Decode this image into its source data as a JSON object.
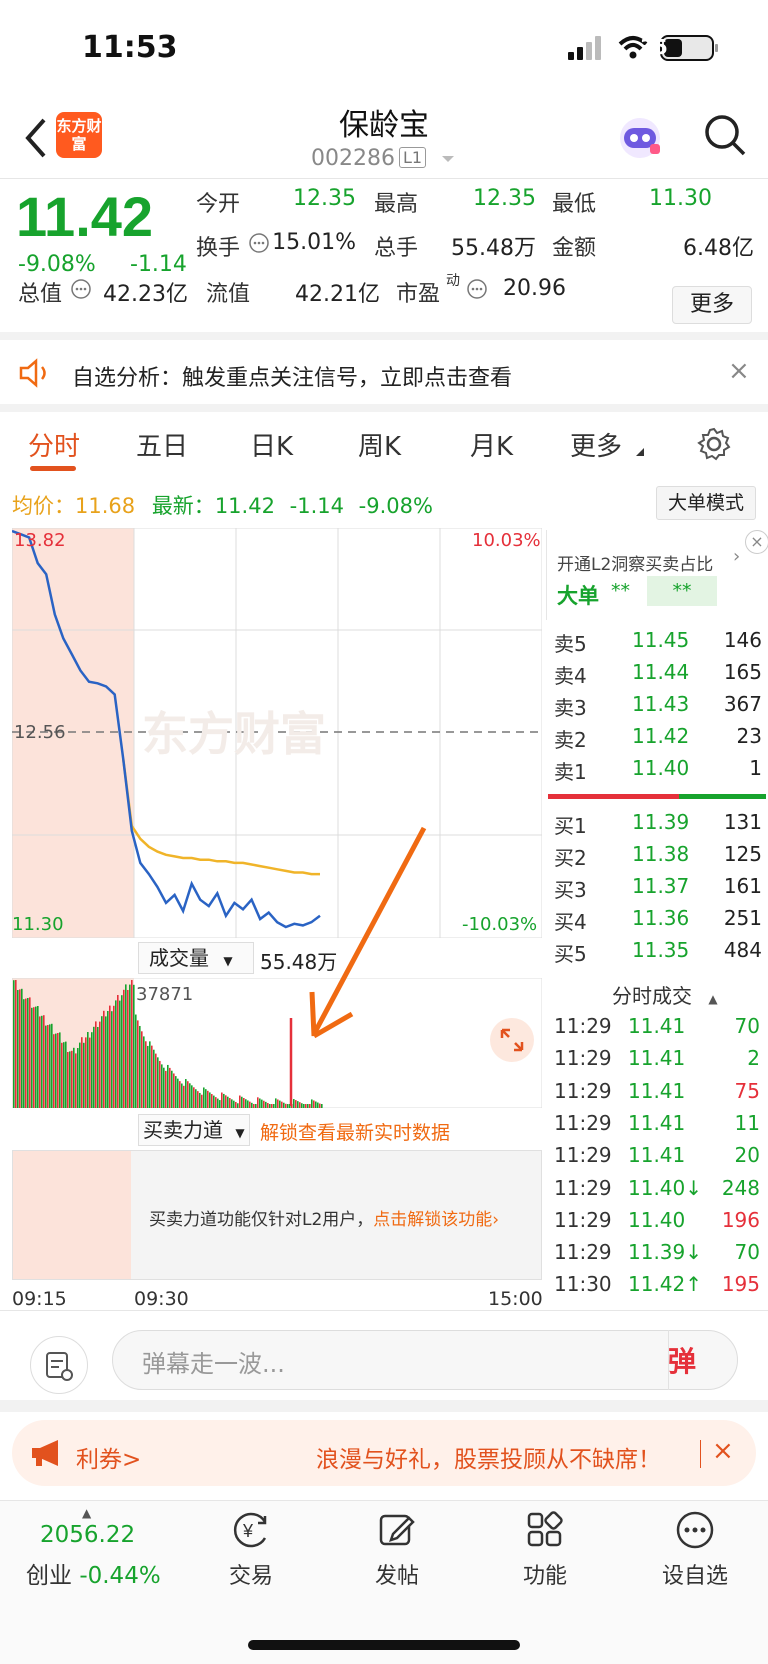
{
  "status_bar": {
    "time": "11:53",
    "battery": "35"
  },
  "header": {
    "logo_text": "东方财富",
    "title": "保龄宝",
    "code": "002286",
    "level_tag": "L1"
  },
  "quote": {
    "price": "11.42",
    "change_pct": "-9.08%",
    "change": "-1.14",
    "stats": [
      {
        "label": "今开",
        "value": "12.35",
        "color": "green"
      },
      {
        "label": "最高",
        "value": "12.35",
        "color": "green"
      },
      {
        "label": "最低",
        "value": "11.30",
        "color": "green"
      },
      {
        "label": "换手",
        "value": "15.01%",
        "color": "black"
      },
      {
        "label": "总手",
        "value": "55.48万",
        "color": "black"
      },
      {
        "label": "金额",
        "value": "6.48亿",
        "color": "black"
      },
      {
        "label": "总值",
        "value": "42.23亿",
        "color": "black"
      },
      {
        "label": "流值",
        "value": "42.21亿",
        "color": "black"
      },
      {
        "label": "市盈",
        "value": "20.96",
        "color": "black"
      }
    ],
    "pe_sup": "动",
    "more_button": "更多"
  },
  "banner": {
    "text": "自选分析：触发重点关注信号，立即点击查看",
    "close": "×"
  },
  "tabs": [
    "分时",
    "五日",
    "日K",
    "周K",
    "月K",
    "更多"
  ],
  "info_row": {
    "avg_label": "均价：",
    "avg_value": "11.68",
    "latest_label": "最新：",
    "latest_value": "11.42",
    "change": "-1.14",
    "pct": "-9.08%",
    "mode_button": "大单模式"
  },
  "chart_labels": {
    "top_price": "13.82",
    "top_pct": "10.03%",
    "mid_price": "12.56",
    "bottom_price": "11.30",
    "bottom_pct": "-10.03%",
    "volume_selector": "成交量",
    "volume_total": "55.48万",
    "volume_max": "37871",
    "force_selector": "买卖力道",
    "force_unlock": "解锁查看最新实时数据",
    "force_note": "买卖力道功能仅针对L2用户，",
    "force_link": "点击解锁该功能",
    "time_start": "09:15",
    "time_mid": "09:30",
    "time_end": "15:00",
    "watermark": "东方财富"
  },
  "chart_data": {
    "type": "line",
    "title": "",
    "xlabel": "",
    "ylabel": "",
    "ylim": [
      11.3,
      13.82
    ],
    "x_ticks": [
      "09:15",
      "09:30",
      "15:00"
    ],
    "series": [
      {
        "values": [
          13.82,
          13.8,
          13.78,
          13.62,
          13.55,
          13.3,
          13.15,
          13.05,
          12.95,
          12.88,
          12.87,
          12.85,
          12.8,
          12.4,
          11.95,
          11.75,
          11.68,
          11.6,
          11.5,
          11.55,
          11.45,
          11.62,
          11.52,
          11.48,
          11.56,
          11.42,
          11.5,
          11.46,
          11.52,
          11.4,
          11.44,
          11.38,
          11.35,
          11.37,
          11.36,
          11.38,
          11.42
        ],
        "color": "#2a63c4"
      },
      {
        "values": [
          null,
          null,
          null,
          null,
          null,
          null,
          null,
          null,
          null,
          null,
          null,
          null,
          null,
          12.4,
          11.98,
          11.9,
          11.85,
          11.82,
          11.8,
          11.79,
          11.78,
          11.78,
          11.77,
          11.77,
          11.76,
          11.76,
          11.75,
          11.75,
          11.74,
          11.73,
          11.72,
          11.71,
          11.7,
          11.69,
          11.69,
          11.68,
          11.68
        ],
        "color": "#f0b429"
      }
    ]
  },
  "order_book": {
    "header": "开通L2洞察买卖占比",
    "big_order": "大单",
    "masked": "**",
    "asks": [
      {
        "label": "卖5",
        "price": "11.45",
        "vol": "146"
      },
      {
        "label": "卖4",
        "price": "11.44",
        "vol": "165"
      },
      {
        "label": "卖3",
        "price": "11.43",
        "vol": "367"
      },
      {
        "label": "卖2",
        "price": "11.42",
        "vol": "23"
      },
      {
        "label": "卖1",
        "price": "11.40",
        "vol": "1"
      }
    ],
    "bids": [
      {
        "label": "买1",
        "price": "11.39",
        "vol": "131"
      },
      {
        "label": "买2",
        "price": "11.38",
        "vol": "125"
      },
      {
        "label": "买3",
        "price": "11.37",
        "vol": "161"
      },
      {
        "label": "买4",
        "price": "11.36",
        "vol": "251"
      },
      {
        "label": "买5",
        "price": "11.35",
        "vol": "484"
      }
    ],
    "ask_ratio": 0.6
  },
  "trades": {
    "header": "分时成交",
    "rows": [
      {
        "time": "11:29",
        "price": "11.41",
        "vol": "70",
        "dir": "green"
      },
      {
        "time": "11:29",
        "price": "11.41",
        "vol": "2",
        "dir": "green"
      },
      {
        "time": "11:29",
        "price": "11.41",
        "vol": "75",
        "dir": "red"
      },
      {
        "time": "11:29",
        "price": "11.41",
        "vol": "11",
        "dir": "green"
      },
      {
        "time": "11:29",
        "price": "11.41",
        "vol": "20",
        "dir": "green"
      },
      {
        "time": "11:29",
        "price": "11.40↓",
        "vol": "248",
        "dir": "green"
      },
      {
        "time": "11:29",
        "price": "11.40",
        "vol": "196",
        "dir": "red"
      },
      {
        "time": "11:29",
        "price": "11.39↓",
        "vol": "70",
        "dir": "green"
      },
      {
        "time": "11:30",
        "price": "11.42↑",
        "vol": "195",
        "dir": "red"
      }
    ]
  },
  "comment_bar": {
    "placeholder": "弹幕走一波...",
    "danmu_button": "弹"
  },
  "promo": {
    "left_text": "利券>",
    "text": "浪漫与好礼，股票投顾从不缺席！",
    "close": "×"
  },
  "bottom_nav": {
    "index_value": "2056.22",
    "index_name": "创业",
    "index_change": "-0.44%",
    "items": [
      "交易",
      "发帖",
      "功能",
      "设自选"
    ]
  }
}
